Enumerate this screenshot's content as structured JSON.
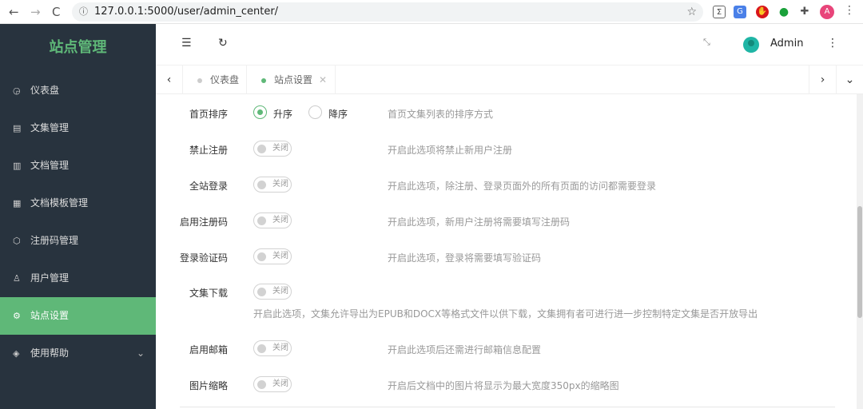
{
  "browser": {
    "url": "127.0.0.1:5000/user/admin_center/",
    "profile_initial": "A"
  },
  "sidebar": {
    "brand": "站点管理",
    "items": [
      {
        "label": "仪表盘",
        "icon": "◶"
      },
      {
        "label": "文集管理",
        "icon": "▤"
      },
      {
        "label": "文档管理",
        "icon": "▥"
      },
      {
        "label": "文档模板管理",
        "icon": "▦"
      },
      {
        "label": "注册码管理",
        "icon": "⬡"
      },
      {
        "label": "用户管理",
        "icon": "♙"
      },
      {
        "label": "站点设置",
        "icon": "⚙"
      },
      {
        "label": "使用帮助",
        "icon": "◈"
      }
    ]
  },
  "header": {
    "username": "Admin"
  },
  "tabs": [
    {
      "label": "仪表盘"
    },
    {
      "label": "站点设置"
    }
  ],
  "settings": {
    "sort": {
      "label": "首页排序",
      "asc": "升序",
      "desc": "降序",
      "selected": "升序",
      "help": "首页文集列表的排序方式"
    },
    "switch_off": "关闭",
    "rows": [
      {
        "label": "禁止注册",
        "help": "开启此选项将禁止新用户注册"
      },
      {
        "label": "全站登录",
        "help": "开启此选项，除注册、登录页面外的所有页面的访问都需要登录"
      },
      {
        "label": "启用注册码",
        "help": "开启此选项，新用户注册将需要填写注册码"
      },
      {
        "label": "登录验证码",
        "help": "开启此选项，登录将需要填写验证码"
      },
      {
        "label": "文集下载",
        "help": "开启此选项，文集允许导出为EPUB和DOCX等格式文件以供下载，文集拥有者可进行进一步控制特定文集是否开放导出"
      },
      {
        "label": "启用邮箱",
        "help": "开启此选项后还需进行邮箱信息配置"
      },
      {
        "label": "图片缩略",
        "help": "开启后文档中的图片将显示为最大宽度350px的缩略图"
      }
    ]
  }
}
